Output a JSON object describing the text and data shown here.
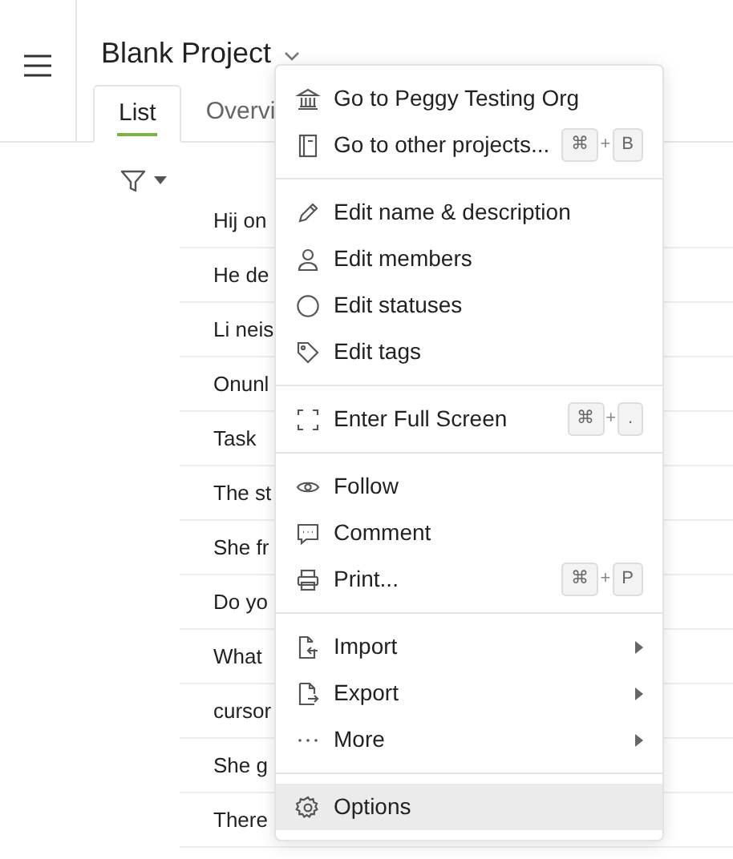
{
  "header": {
    "title": "Blank Project"
  },
  "tabs": [
    {
      "label": "List",
      "selected": true
    },
    {
      "label": "Overvi",
      "selected": false
    }
  ],
  "rows": [
    "Hij on",
    "He de",
    "Li neis",
    "Onunl",
    "Task",
    "The st",
    "She fr",
    "Do yo",
    "What",
    "cursor",
    "She g",
    "There"
  ],
  "menu": {
    "sections": [
      [
        {
          "label": "Go to Peggy Testing Org",
          "selected": false,
          "submenu": false
        },
        {
          "label": "Go to other projects...",
          "selected": false,
          "submenu": false,
          "shortcut": [
            "⌘",
            "+",
            "B"
          ]
        }
      ],
      [
        {
          "label": "Edit name & description",
          "selected": false,
          "submenu": false
        },
        {
          "label": "Edit members",
          "selected": false,
          "submenu": false
        },
        {
          "label": "Edit statuses",
          "selected": false,
          "submenu": false
        },
        {
          "label": "Edit tags",
          "selected": false,
          "submenu": false
        }
      ],
      [
        {
          "label": "Enter Full Screen",
          "selected": false,
          "submenu": false,
          "shortcut": [
            "⌘",
            "+",
            "."
          ]
        }
      ],
      [
        {
          "label": "Follow",
          "selected": false,
          "submenu": false
        },
        {
          "label": "Comment",
          "selected": false,
          "submenu": false
        },
        {
          "label": "Print...",
          "selected": false,
          "submenu": false,
          "shortcut": [
            "⌘",
            "+",
            "P"
          ]
        }
      ],
      [
        {
          "label": "Import",
          "selected": false,
          "submenu": true
        },
        {
          "label": "Export",
          "selected": false,
          "submenu": true
        },
        {
          "label": "More",
          "selected": false,
          "submenu": true
        }
      ],
      [
        {
          "label": "Options",
          "selected": true,
          "submenu": false
        }
      ]
    ]
  }
}
